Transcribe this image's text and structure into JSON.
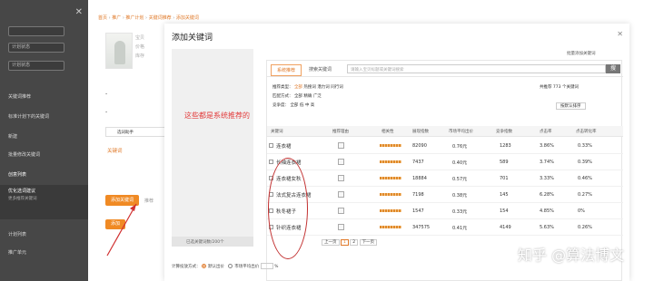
{
  "sidebar": {
    "close": "✕",
    "selects": [
      "",
      "计划状态",
      "计划状态"
    ],
    "items": [
      "关键词推荐",
      "标准计划下的关键词",
      "新建",
      "批量修改关键词",
      "创意列表"
    ],
    "active_title": "优化选词建议",
    "active_desc": "更多推荐关键词",
    "more": [
      "计划列表",
      "推广单元"
    ]
  },
  "breadcrumb": [
    "首页",
    "推广",
    "推广计划",
    "关键词推荐",
    "添加关键词"
  ],
  "left": {
    "product_text": [
      "宝贝",
      "价格",
      "库存"
    ],
    "dash": "-",
    "ad_text": "选词助手",
    "keyword_link": "关键词",
    "btn1": "添加关键词",
    "btn1_side": "推荐",
    "btn_icon": "添加"
  },
  "dialog": {
    "title": "添加关键词",
    "close": "✕",
    "annotation": "这些都是系统推荐的",
    "count_text": "已选关键词数/200个"
  },
  "panel": {
    "tab_active": "系统推荐",
    "tab2": "搜索关键词",
    "search_placeholder": "请输入宝贝标题或关键词搜索",
    "search_btn": "搜",
    "right_top": "批量添加关键词",
    "filter_rows": [
      [
        "推荐类型：",
        "全部",
        "热搜词",
        "潜力词",
        "同行词"
      ],
      [
        "匹配方式：",
        "全部",
        "精确",
        "广泛"
      ],
      [
        "竞争度：",
        "全部",
        "低",
        "中",
        "高"
      ]
    ],
    "total": "共推荐 773 个关键词",
    "sort": "按默认排序",
    "headers": [
      "关键词",
      "推荐理由",
      "相关性",
      "展现指数",
      "市场平均出价",
      "竞争指数",
      "点击率",
      "点击转化率"
    ],
    "rows": [
      {
        "kw": "连衣裙",
        "idx": "82090",
        "bid": "0.76元",
        "comp": "1283",
        "ctr": "3.86%",
        "cvr": "0.33%"
      },
      {
        "kw": "长袖连衣裙",
        "idx": "7437",
        "bid": "0.40元",
        "comp": "589",
        "ctr": "3.74%",
        "cvr": "0.39%"
      },
      {
        "kw": "连衣裙女秋",
        "idx": "18884",
        "bid": "0.57元",
        "comp": "701",
        "ctr": "3.33%",
        "cvr": "0.46%"
      },
      {
        "kw": "法式复古连衣裙",
        "idx": "7198",
        "bid": "0.38元",
        "comp": "145",
        "ctr": "6.28%",
        "cvr": "0.27%"
      },
      {
        "kw": "秋冬裙子",
        "idx": "1547",
        "bid": "0.33元",
        "comp": "154",
        "ctr": "4.85%",
        "cvr": "0%"
      },
      {
        "kw": "针织连衣裙",
        "idx": "347575",
        "bid": "0.41元",
        "comp": "4149",
        "ctr": "5.63%",
        "cvr": "0.26%"
      }
    ],
    "pagination": [
      "上一页",
      "1",
      "2",
      "下一页"
    ]
  },
  "footer": {
    "label": "计算投放方式：",
    "opt1": "默认出价",
    "opt2": "市场平均出价",
    "pct": "%"
  },
  "watermark": "知乎 @算法博文"
}
